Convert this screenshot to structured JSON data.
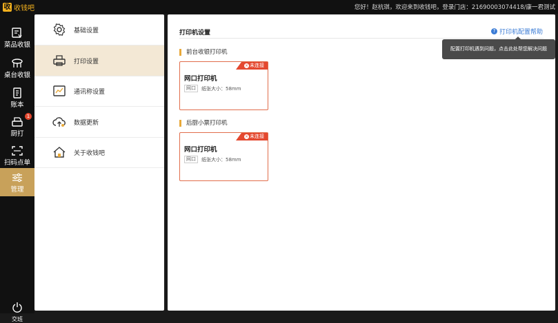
{
  "app": {
    "logo_glyph": "收",
    "logo_text": "收钱吧",
    "accent": "#c8a15a",
    "brand": "#f2b01e"
  },
  "topbar": {
    "welcome": "您好！赵杭琪，欢迎来到收钱吧，登录门店：21690003074418/康一君测试"
  },
  "nav": {
    "items": [
      {
        "label": "菜品收银",
        "icon": "cashier-icon"
      },
      {
        "label": "桌台收银",
        "icon": "table-icon"
      },
      {
        "label": "账本",
        "icon": "ledger-icon"
      },
      {
        "label": "厨打",
        "icon": "kitchen-printer-icon",
        "badge": "1"
      },
      {
        "label": "扫码点单",
        "icon": "scan-icon"
      },
      {
        "label": "管理",
        "icon": "settings-sliders-icon",
        "active": true
      }
    ],
    "logout_label": "交班"
  },
  "settings_menu": {
    "items": [
      {
        "label": "基础设置",
        "icon": "gear-icon"
      },
      {
        "label": "打印设置",
        "icon": "printer-icon",
        "active": true
      },
      {
        "label": "通讯称设置",
        "icon": "scale-icon"
      },
      {
        "label": "数据更新",
        "icon": "cloud-upload-icon"
      },
      {
        "label": "关于收钱吧",
        "icon": "home-icon"
      }
    ]
  },
  "printer_settings": {
    "title": "打印机设置",
    "help_link": "打印机配置帮助",
    "tooltip": "配置打印机遇到问题，点击此处帮您解决问题",
    "sections": [
      {
        "label": "前台收银打印机",
        "card": {
          "status": "未连接",
          "name": "网口打印机",
          "type": "网口",
          "paper": "纸张大小：58mm"
        }
      },
      {
        "label": "后厨小票打印机",
        "card": {
          "status": "未连接",
          "name": "网口打印机",
          "type": "网口",
          "paper": "纸张大小：58mm"
        }
      }
    ]
  }
}
